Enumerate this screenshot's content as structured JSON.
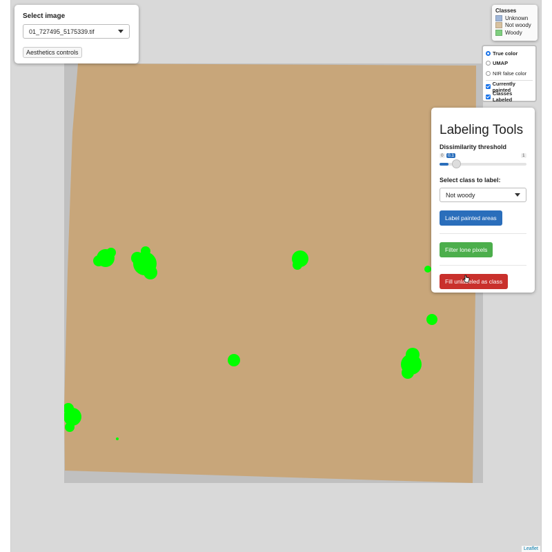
{
  "select_image": {
    "label": "Select image",
    "selected": "01_727495_5175339.tif",
    "aesthetics_button": "Aesthetics controls"
  },
  "legend": {
    "title": "Classes",
    "items": [
      {
        "label": "Unknown",
        "color": "#9fb6d8"
      },
      {
        "label": "Not woody",
        "color": "#d8c2a0"
      },
      {
        "label": "Woody",
        "color": "#7fcf7f"
      }
    ]
  },
  "layers": {
    "base": [
      {
        "label": "True color",
        "selected": true
      },
      {
        "label": "UMAP",
        "selected": false
      },
      {
        "label": "NIR false color",
        "selected": false
      }
    ],
    "overlays": [
      {
        "label": "Currently painted",
        "checked": true
      },
      {
        "label": "Classes Labeled",
        "checked": true
      }
    ]
  },
  "tools": {
    "title": "Labeling Tools",
    "threshold_label": "Dissimilarity threshold",
    "threshold_min": "0",
    "threshold_max": "1",
    "threshold_value": "0.1",
    "threshold_fraction": 0.1,
    "class_label": "Select class to label:",
    "class_selected": "Not woody",
    "label_button": "Label painted areas",
    "filter_button": "Filter lone pixels",
    "fill_button": "Fill unlabeled as class"
  },
  "map": {
    "raster_color": "#c8a67a",
    "woody_color": "#00ff00",
    "attribution": "Leaflet"
  }
}
